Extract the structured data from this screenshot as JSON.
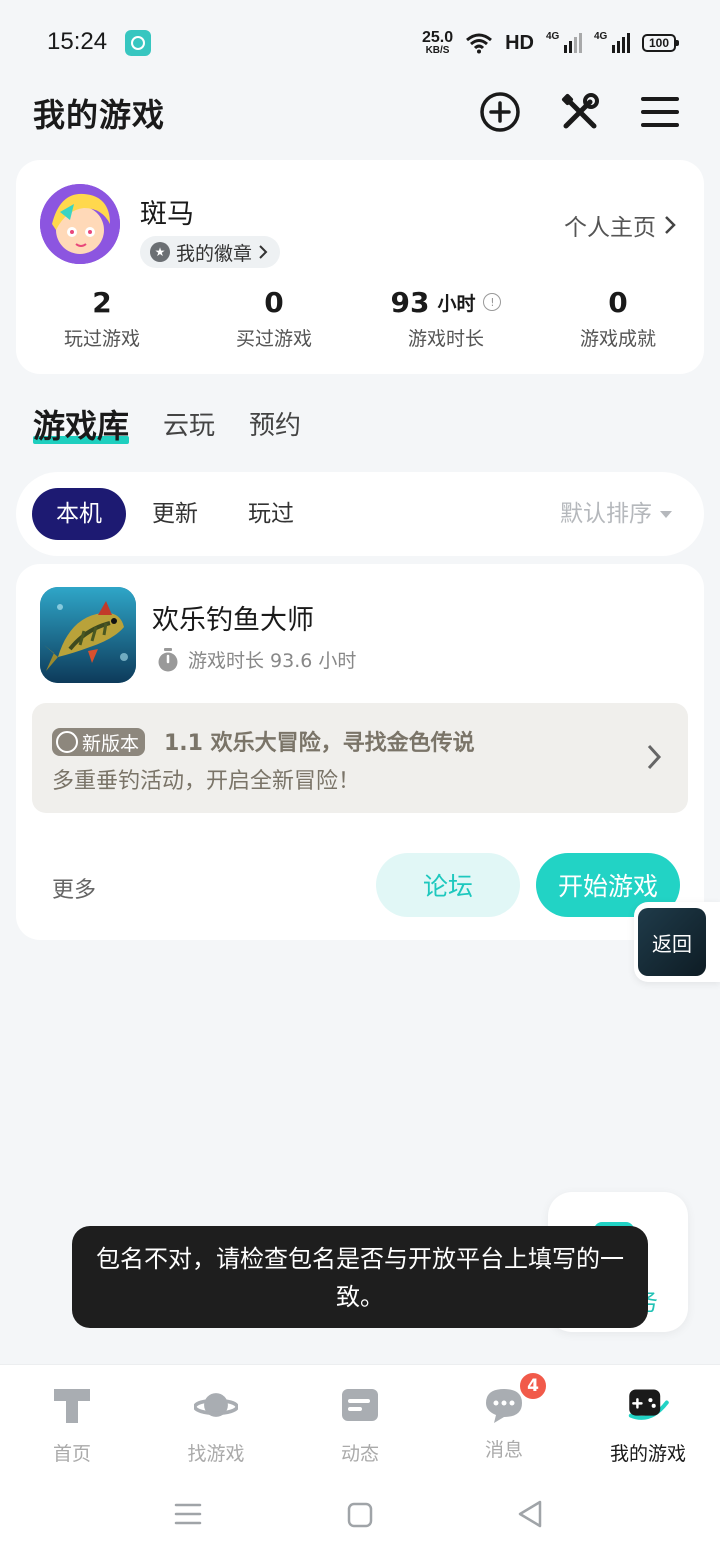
{
  "status_bar": {
    "time": "15:24",
    "net_speed": "25.0",
    "net_unit": "KB/S",
    "hd": "HD",
    "signal_1": "4G",
    "signal_2": "4G",
    "battery": "100"
  },
  "header": {
    "title": "我的游戏"
  },
  "profile": {
    "username": "斑马",
    "badge_label": "我的徽章",
    "homepage_label": "个人主页",
    "stats": [
      {
        "value": "2",
        "unit": "",
        "label": "玩过游戏"
      },
      {
        "value": "0",
        "unit": "",
        "label": "买过游戏"
      },
      {
        "value": "93",
        "unit": "小时",
        "label": "游戏时长"
      },
      {
        "value": "0",
        "unit": "",
        "label": "游戏成就"
      }
    ]
  },
  "main_tabs": [
    "游戏库",
    "云玩",
    "预约"
  ],
  "filter": {
    "chips": [
      "本机",
      "更新",
      "玩过"
    ],
    "sort_label": "默认排序"
  },
  "game": {
    "name": "欢乐钓鱼大师",
    "play_time": "游戏时长 93.6 小时",
    "new_tag": "新版本",
    "news_title": "1.1 欢乐大冒险，寻找金色传说",
    "news_sub": "多重垂钓活动，开启全新冒险！",
    "more_label": "更多",
    "forum_label": "论坛",
    "play_label": "开始游戏"
  },
  "float_return_label": "返回",
  "task_widget_label": "务",
  "toast": "包名不对，请检查包名是否与开放平台上填写的一致。",
  "bottom_nav": {
    "items": [
      {
        "label": "首页",
        "icon": "home-icon"
      },
      {
        "label": "找游戏",
        "icon": "planet-icon"
      },
      {
        "label": "动态",
        "icon": "feed-icon"
      },
      {
        "label": "消息",
        "icon": "chat-icon",
        "badge": "4"
      },
      {
        "label": "我的游戏",
        "icon": "gamepad-icon",
        "active": true
      }
    ]
  },
  "colors": {
    "accent": "#22d3c5",
    "chip_active": "#1d1a72",
    "badge_red": "#f15a4a"
  }
}
